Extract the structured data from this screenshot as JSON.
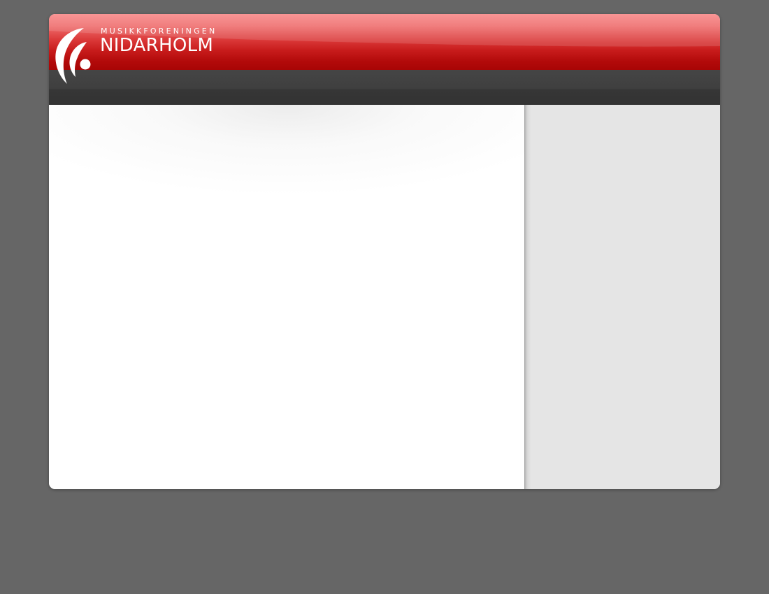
{
  "header": {
    "logo": {
      "kicker": "MUSIKKFORENINGEN",
      "name": "NIDARHOLM",
      "icon": "stylized-f-logo-icon"
    }
  },
  "colors": {
    "background": "#666666",
    "header_red": "#c81c1c",
    "header_red_light": "#f88686",
    "navbar": "#3f3f3f",
    "content": "#ffffff",
    "sidebar": "#e5e5e5"
  }
}
